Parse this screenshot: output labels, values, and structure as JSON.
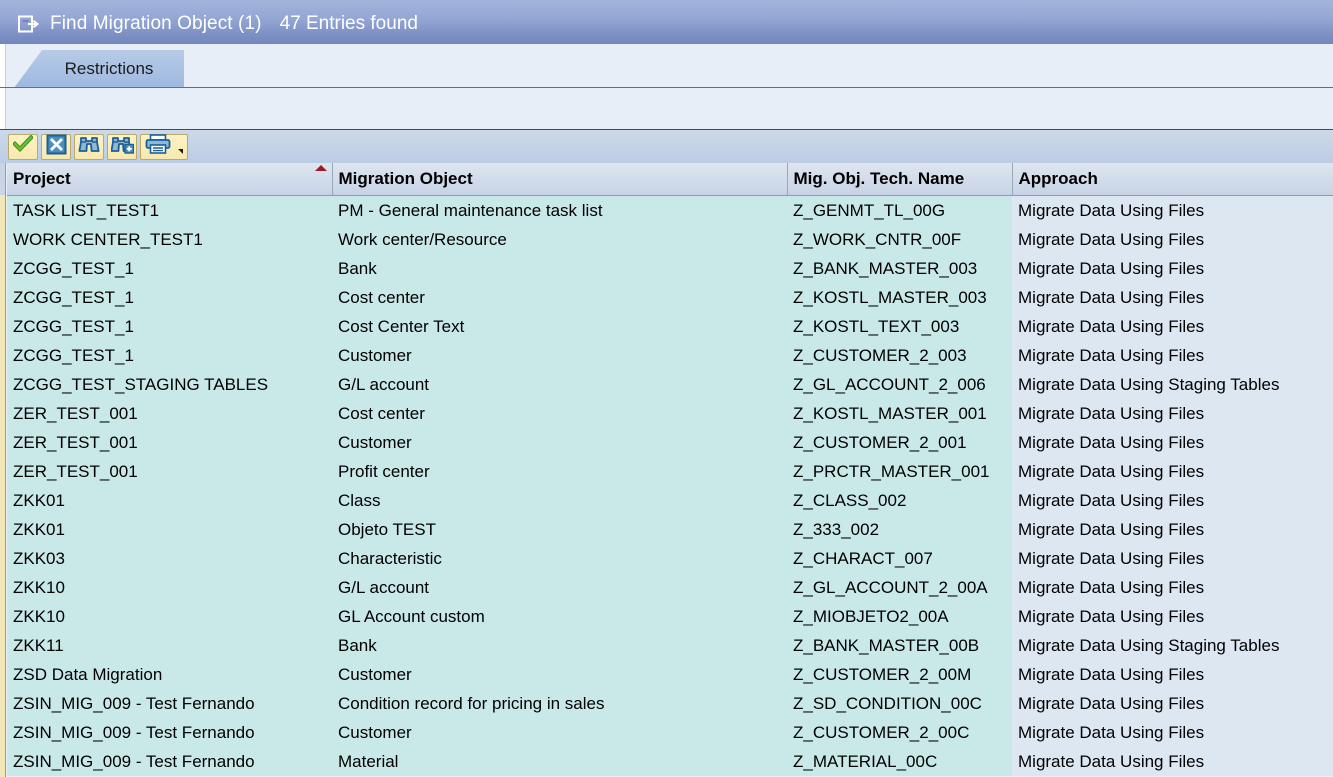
{
  "window": {
    "icon": "dialog-window-icon",
    "title": "Find Migration Object (1)",
    "entries_found": "47 Entries found"
  },
  "tabs": [
    {
      "label": "Restrictions",
      "name": "tab-restrictions",
      "selected": true
    }
  ],
  "toolbar": {
    "buttons": [
      {
        "name": "confirm-button",
        "icon": "green-check-icon",
        "tooltip": "Copy"
      },
      {
        "name": "cancel-button",
        "icon": "cancel-x-icon",
        "tooltip": "Cancel"
      },
      {
        "name": "find-button",
        "icon": "binoculars-icon",
        "tooltip": "Find"
      },
      {
        "name": "find-next-button",
        "icon": "binoculars-plus-icon",
        "tooltip": "Find Next"
      },
      {
        "name": "print-button",
        "icon": "printer-icon",
        "tooltip": "Print"
      },
      {
        "name": "print-menu-button",
        "icon": "chevron-down-icon",
        "tooltip": "More"
      }
    ]
  },
  "table": {
    "sort_column_index": 0,
    "sort_direction": "ascending",
    "columns": [
      {
        "label": "Project",
        "name": "column-header-project"
      },
      {
        "label": "Migration Object",
        "name": "column-header-migration-object"
      },
      {
        "label": "Mig. Obj. Tech. Name",
        "name": "column-header-tech-name"
      },
      {
        "label": "Approach",
        "name": "column-header-approach"
      }
    ],
    "rows": [
      [
        "TASK LIST_TEST1",
        "PM - General maintenance task list",
        "Z_GENMT_TL_00G",
        "Migrate Data Using Files"
      ],
      [
        "WORK CENTER_TEST1",
        "Work center/Resource",
        "Z_WORK_CNTR_00F",
        "Migrate Data Using Files"
      ],
      [
        "ZCGG_TEST_1",
        "Bank",
        "Z_BANK_MASTER_003",
        "Migrate Data Using Files"
      ],
      [
        "ZCGG_TEST_1",
        "Cost center",
        "Z_KOSTL_MASTER_003",
        "Migrate Data Using Files"
      ],
      [
        "ZCGG_TEST_1",
        "Cost Center Text",
        "Z_KOSTL_TEXT_003",
        "Migrate Data Using Files"
      ],
      [
        "ZCGG_TEST_1",
        "Customer",
        "Z_CUSTOMER_2_003",
        "Migrate Data Using Files"
      ],
      [
        "ZCGG_TEST_STAGING TABLES",
        "G/L account",
        "Z_GL_ACCOUNT_2_006",
        "Migrate Data Using Staging Tables"
      ],
      [
        "ZER_TEST_001",
        "Cost center",
        "Z_KOSTL_MASTER_001",
        "Migrate Data Using Files"
      ],
      [
        "ZER_TEST_001",
        "Customer",
        "Z_CUSTOMER_2_001",
        "Migrate Data Using Files"
      ],
      [
        "ZER_TEST_001",
        "Profit center",
        "Z_PRCTR_MASTER_001",
        "Migrate Data Using Files"
      ],
      [
        "ZKK01",
        "Class",
        "Z_CLASS_002",
        "Migrate Data Using Files"
      ],
      [
        "ZKK01",
        "Objeto TEST",
        "Z_333_002",
        "Migrate Data Using Files"
      ],
      [
        "ZKK03",
        "Characteristic",
        "Z_CHARACT_007",
        "Migrate Data Using Files"
      ],
      [
        "ZKK10",
        "G/L account",
        "Z_GL_ACCOUNT_2_00A",
        "Migrate Data Using Files"
      ],
      [
        "ZKK10",
        "GL Account custom",
        "Z_MIOBJETO2_00A",
        "Migrate Data Using Files"
      ],
      [
        "ZKK11",
        "Bank",
        "Z_BANK_MASTER_00B",
        "Migrate Data Using Staging Tables"
      ],
      [
        "ZSD Data Migration",
        "Customer",
        "Z_CUSTOMER_2_00M",
        "Migrate Data Using Files"
      ],
      [
        "ZSIN_MIG_009 - Test Fernando",
        "Condition record for pricing in sales",
        "Z_SD_CONDITION_00C",
        "Migrate Data Using Files"
      ],
      [
        "ZSIN_MIG_009 - Test Fernando",
        "Customer",
        "Z_CUSTOMER_2_00C",
        "Migrate Data Using Files"
      ],
      [
        "ZSIN_MIG_009 - Test Fernando",
        "Material",
        "Z_MATERIAL_00C",
        "Migrate Data Using Files"
      ]
    ]
  },
  "colors": {
    "titlebar": "#93a5d3",
    "tab_active": "#a9c0e3",
    "toolbar": "#c3d2e6",
    "header": "#d2dceb",
    "cell_key": "#c9e9e9",
    "cell_approach": "#dde7f2",
    "sort_indicator": "#9d1a2e",
    "rail": "#f2e7b6"
  }
}
